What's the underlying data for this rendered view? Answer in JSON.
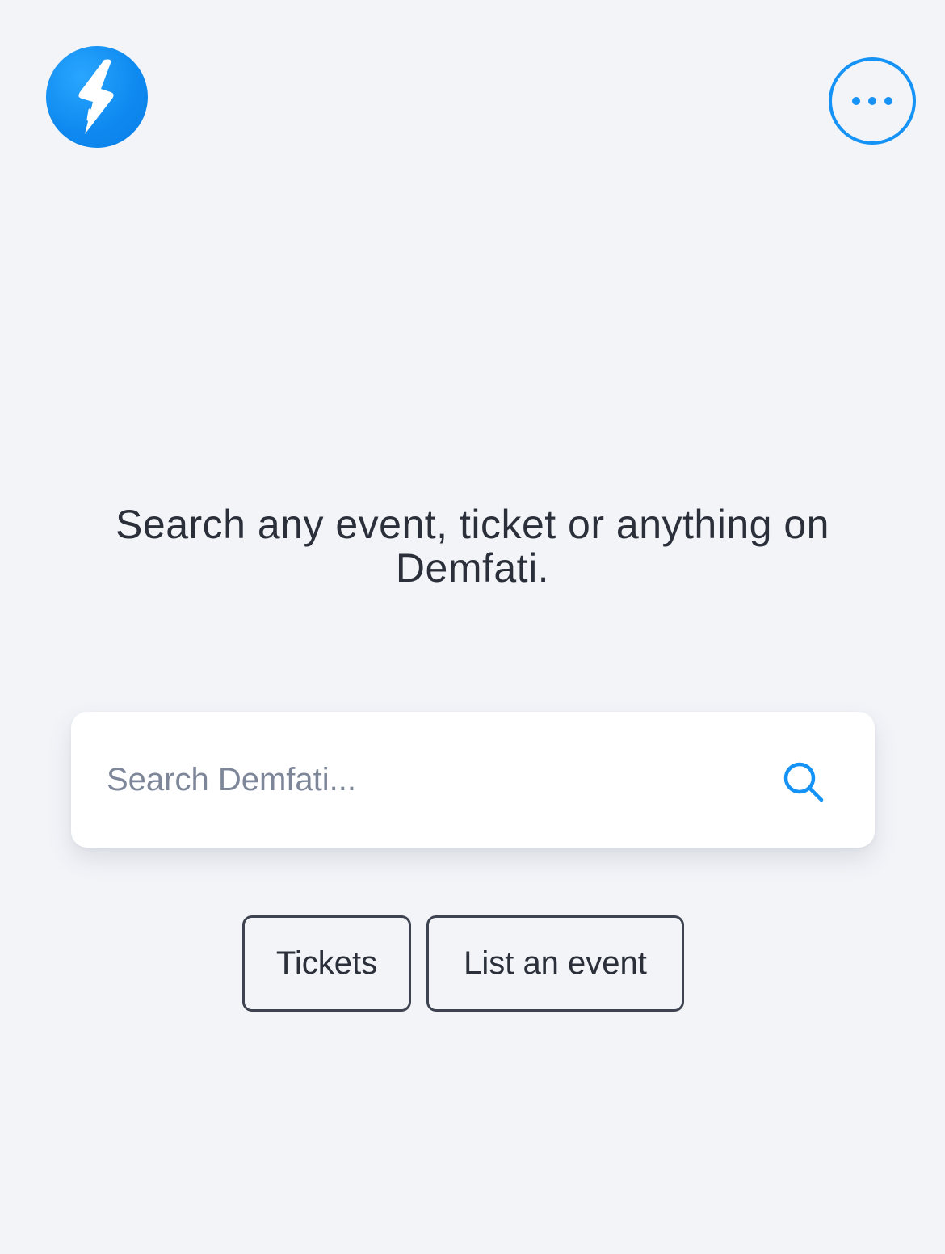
{
  "header": {
    "logo_icon": "lightning-bolt-icon",
    "menu_icon": "more-horizontal-icon",
    "accent_color": "#1592f5"
  },
  "main": {
    "headline": "Search any event, ticket or anything on Demfati."
  },
  "search": {
    "placeholder": "Search Demfati...",
    "value": "",
    "icon": "search-icon"
  },
  "actions": {
    "tickets_label": "Tickets",
    "list_event_label": "List an event"
  }
}
